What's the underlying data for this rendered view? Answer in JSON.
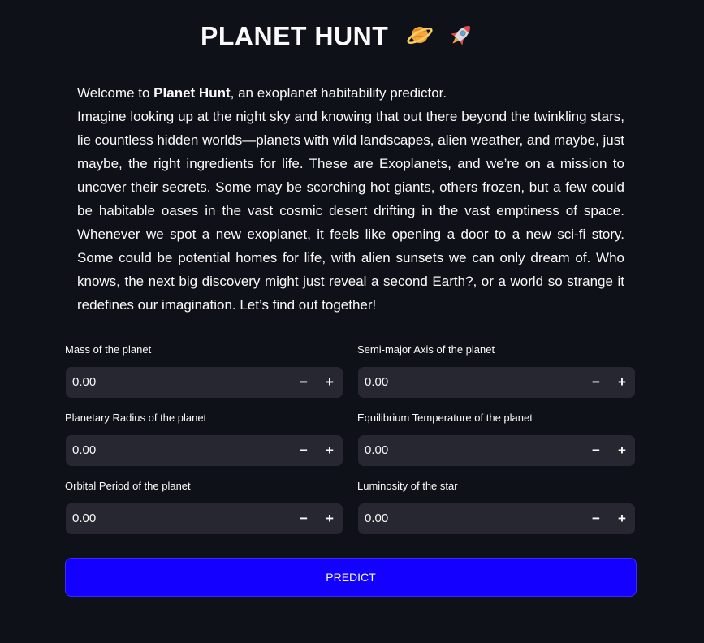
{
  "header": {
    "title": "PLANET HUNT",
    "icons": [
      "ringed-planet-icon",
      "rocket-icon"
    ]
  },
  "intro": {
    "welcome_prefix": "Welcome to ",
    "app_name": "Planet Hunt",
    "welcome_suffix": ", an exoplanet habitability predictor.",
    "body": "Imagine looking up at the night sky and knowing that out there beyond the twinkling stars, lie countless hidden worlds—planets with wild landscapes, alien weather, and maybe, just maybe, the right ingredients for life. These are Exoplanets, and we’re on a mission to uncover their secrets. Some may be scorching hot giants, others frozen, but a few could be habitable oases in the vast cosmic desert drifting in the vast emptiness of space. Whenever we spot a new exoplanet, it feels like opening a door to a new sci-fi story. Some could be potential homes for life, with alien sunsets we can only dream of. Who knows, the next big discovery might just reveal a second Earth?, or a world so strange it redefines our imagination. Let’s find out together!"
  },
  "inputs": {
    "mass": {
      "label": "Mass of the planet",
      "value": "0.00"
    },
    "semi_major_axis": {
      "label": "Semi-major Axis of the planet",
      "value": "0.00"
    },
    "radius": {
      "label": "Planetary Radius of the planet",
      "value": "0.00"
    },
    "eq_temp": {
      "label": "Equilibrium Temperature of the planet",
      "value": "0.00"
    },
    "orbital_period": {
      "label": "Orbital Period of the planet",
      "value": "0.00"
    },
    "luminosity": {
      "label": "Luminosity of the star",
      "value": "0.00"
    },
    "minus_symbol": "−",
    "plus_symbol": "+"
  },
  "predict": {
    "label": "PREDICT"
  },
  "colors": {
    "background": "#0e1117",
    "input_background": "#262730",
    "button": "#1400ff",
    "text": "#fafafa"
  }
}
